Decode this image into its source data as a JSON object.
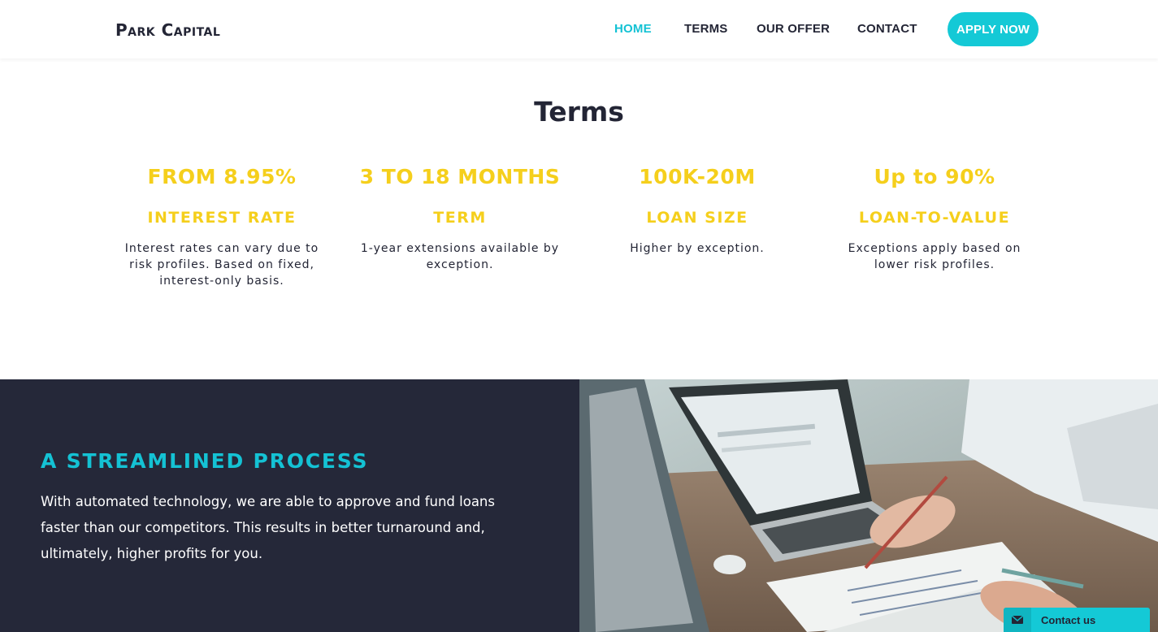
{
  "header": {
    "logo_text": "Park Capital",
    "nav": {
      "home": "HOME",
      "terms": "TERMS",
      "offer": "OUR OFFER",
      "contact": "CONTACT"
    },
    "apply_label": "APPLY NOW"
  },
  "terms": {
    "title": "Terms",
    "items": [
      {
        "value": "FROM 8.95%",
        "label": "INTEREST RATE",
        "desc": "Interest rates can vary due to risk profiles. Based on fixed, interest-only basis."
      },
      {
        "value": "3 TO 18 MONTHS",
        "label": "TERM",
        "desc": "1-year extensions available by exception."
      },
      {
        "value": "100K-20M",
        "label": "LOAN SIZE",
        "desc": "Higher by exception."
      },
      {
        "value": "Up to 90%",
        "label": "LOAN-TO-VALUE",
        "desc": "Exceptions apply based on lower risk profiles."
      }
    ]
  },
  "process": {
    "title": "A STREAMLINED PROCESS",
    "text": "With automated technology, we are able to approve and fund loans faster than our competitors. This results in better turnaround and, ultimately, higher profits for you."
  },
  "contact_widget": {
    "label": "Contact us",
    "icon": "envelope-icon"
  },
  "colors": {
    "accent": "#14c9d6",
    "highlight": "#f5cf1c",
    "dark": "#252839"
  }
}
